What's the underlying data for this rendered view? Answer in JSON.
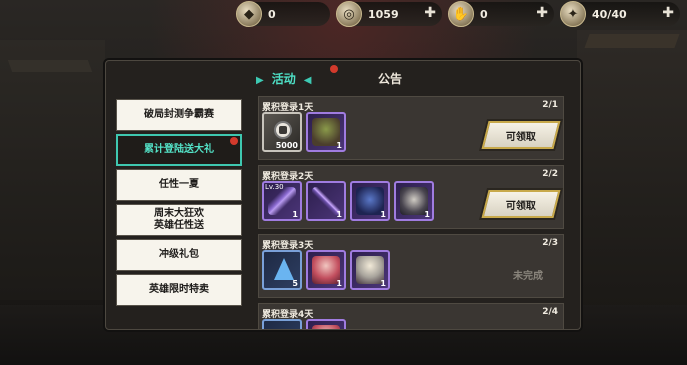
{
  "resources": [
    {
      "icon": "diamond-icon",
      "value": "0",
      "has_plus": false
    },
    {
      "icon": "coin-icon",
      "value": "1059",
      "has_plus": true
    },
    {
      "icon": "hand-icon",
      "value": "0",
      "has_plus": true
    },
    {
      "icon": "stamina-icon",
      "value": "40/40",
      "has_plus": true
    }
  ],
  "tabs": {
    "active_label": "活动",
    "notice_label": "公告"
  },
  "sidebar": {
    "items": [
      {
        "label": "破局封测争霸赛"
      },
      {
        "label": "累计登陆送大礼"
      },
      {
        "label": "任性一夏"
      },
      {
        "label": "周末大狂欢\n英雄任性送"
      },
      {
        "label": "冲级礼包"
      },
      {
        "label": "英雄限时特卖"
      }
    ]
  },
  "rows": [
    {
      "title": "累积登录1天",
      "progress": "2/1",
      "action": "可领取",
      "items": [
        {
          "type": "coin",
          "count": "5000"
        },
        {
          "type": "hero-orc",
          "count": "1"
        }
      ]
    },
    {
      "title": "累积登录2天",
      "progress": "2/2",
      "action": "可领取",
      "items": [
        {
          "type": "weapon-axe",
          "level": "Lv.30",
          "count": "1"
        },
        {
          "type": "weapon-sword",
          "count": "1"
        },
        {
          "type": "hero-blue",
          "count": "1"
        },
        {
          "type": "hero-knight",
          "count": "1"
        }
      ]
    },
    {
      "title": "累积登录3天",
      "progress": "2/3",
      "action": "未完成",
      "items": [
        {
          "type": "crystal",
          "count": "5"
        },
        {
          "type": "hero-red",
          "count": "1"
        },
        {
          "type": "hero-silver",
          "count": "1"
        }
      ]
    },
    {
      "title": "累积登录4天",
      "progress": "2/4",
      "action": "",
      "items": [
        {
          "type": "crystal",
          "count": ""
        },
        {
          "type": "hero-red",
          "count": ""
        }
      ]
    }
  ]
}
